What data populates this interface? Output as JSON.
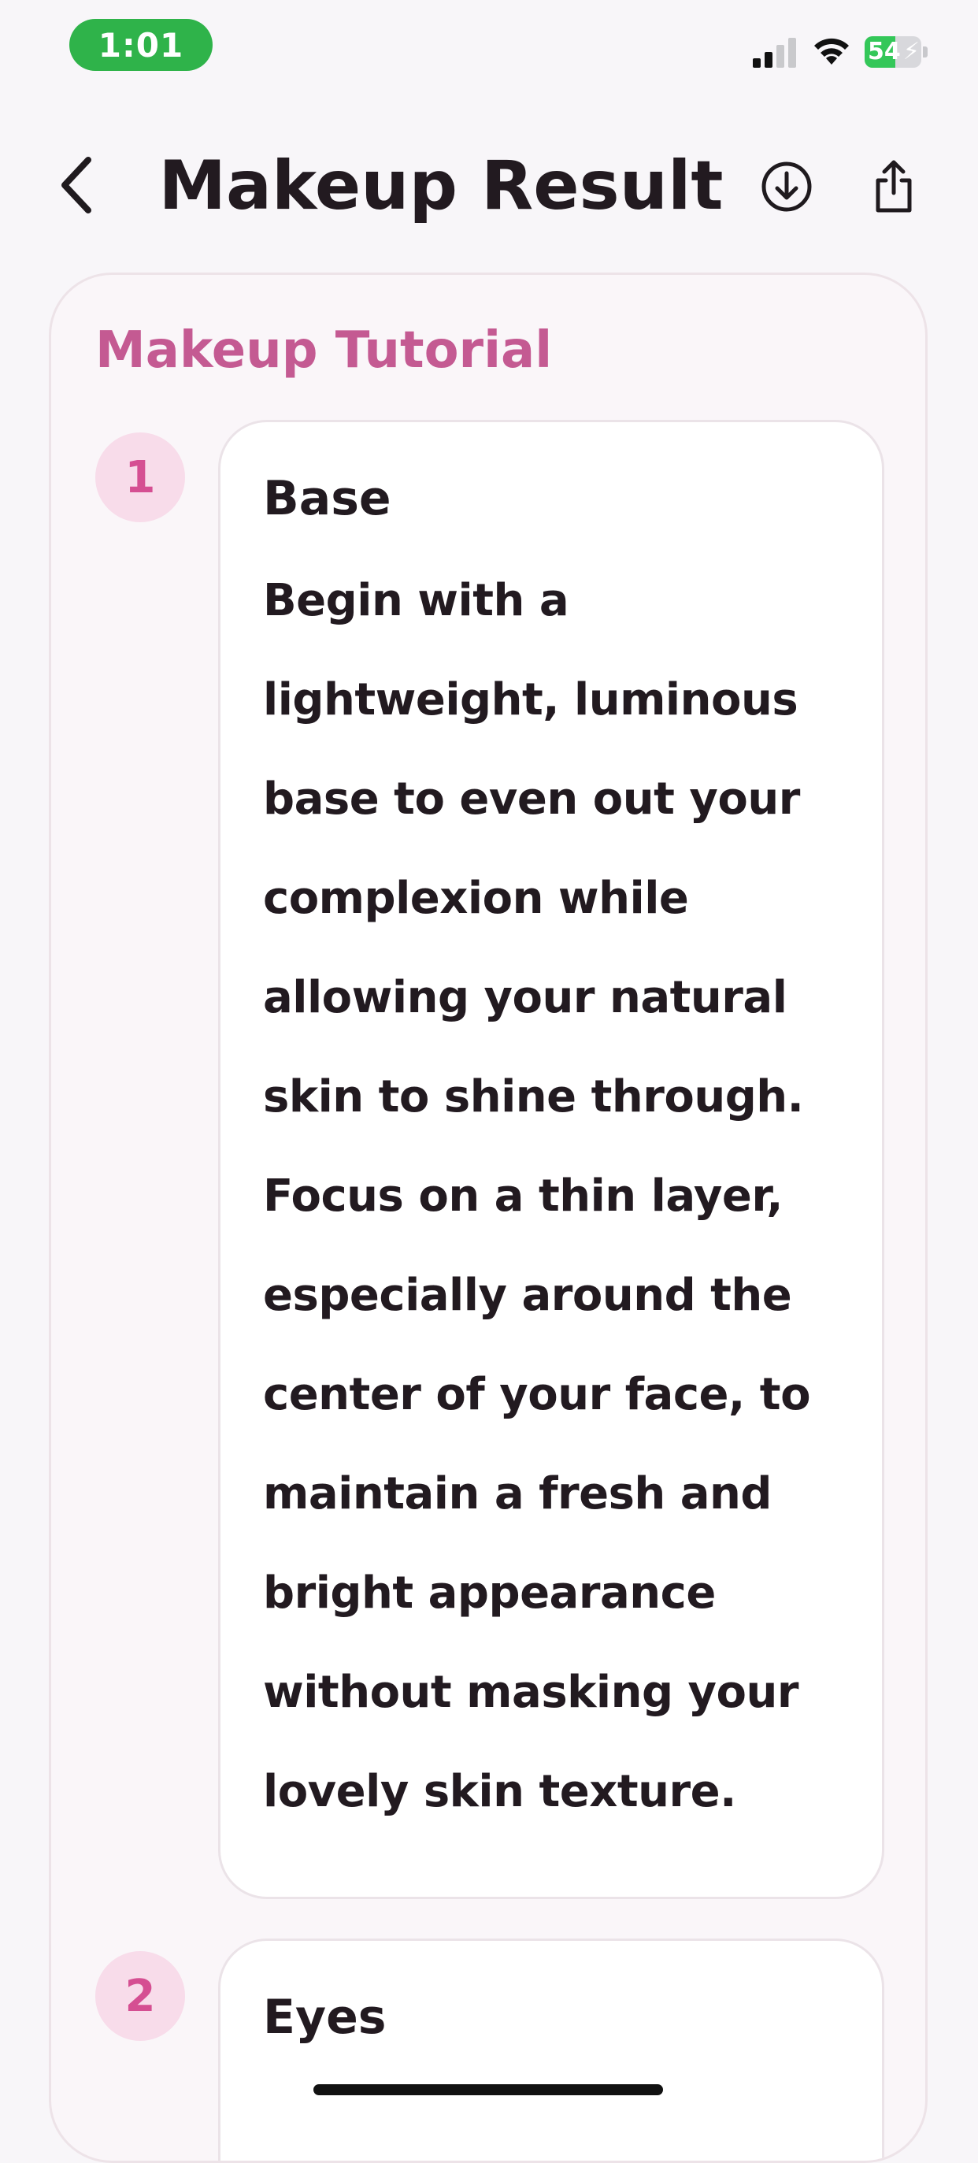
{
  "status_bar": {
    "time": "1:01",
    "battery_level": "54",
    "battery_fraction": 0.54
  },
  "nav": {
    "title": "Makeup Result",
    "icons": {
      "back": "chevron-left-icon",
      "download": "download-circle-icon",
      "share": "share-icon"
    }
  },
  "tutorial": {
    "section_title": "Makeup Tutorial",
    "accent_color": "#c45a92",
    "steps": [
      {
        "number": "1",
        "title": "Base",
        "body": "Begin with a lightweight, luminous base to even out your complexion while allowing your natural skin to shine through. Focus on a thin layer, especially around the center of your face, to maintain a fresh and bright appearance without masking your lovely skin texture."
      },
      {
        "number": "2",
        "title": "Eyes",
        "body": ""
      }
    ]
  }
}
